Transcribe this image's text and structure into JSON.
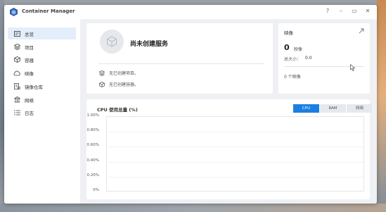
{
  "window": {
    "title": "Container Manager",
    "controls": [
      "?",
      "–",
      "▭",
      "✕"
    ]
  },
  "sidebar": {
    "items": [
      {
        "label": "总览",
        "icon": "overview-icon",
        "active": true
      },
      {
        "label": "项目",
        "icon": "project-icon",
        "active": false
      },
      {
        "label": "容器",
        "icon": "container-icon",
        "active": false
      },
      {
        "label": "映像",
        "icon": "image-cloud-icon",
        "active": false
      },
      {
        "label": "镜像仓库",
        "icon": "registry-icon",
        "active": false
      },
      {
        "label": "网络",
        "icon": "network-icon",
        "active": false
      },
      {
        "label": "日志",
        "icon": "log-icon",
        "active": false
      }
    ]
  },
  "service": {
    "title": "尚未创建服务",
    "rows": [
      {
        "icon": "layers-icon",
        "text": "无已创建项目。"
      },
      {
        "icon": "container-icon",
        "text": "无已创建容器。"
      }
    ]
  },
  "resources": {
    "title": "映像",
    "count": "0",
    "count_unit": "映像",
    "size_label": "总大小：",
    "size_value": "0.0",
    "bottom_text": "0 个映像"
  },
  "chart": {
    "title": "CPU 使用总量 (%)",
    "tabs": [
      {
        "label": "CPU",
        "active": true
      },
      {
        "label": "RAM",
        "active": false
      },
      {
        "label": "网络",
        "active": false
      }
    ],
    "colors": {
      "accent": "#1a7fe0"
    }
  },
  "chart_data": {
    "type": "line",
    "title": "CPU 使用总量 (%)",
    "xlabel": "",
    "ylabel": "",
    "ylim": [
      0,
      1
    ],
    "yticks": [
      "1.00%",
      "0.80%",
      "0.60%",
      "0.40%",
      "0.20%",
      "0%"
    ],
    "series": []
  }
}
